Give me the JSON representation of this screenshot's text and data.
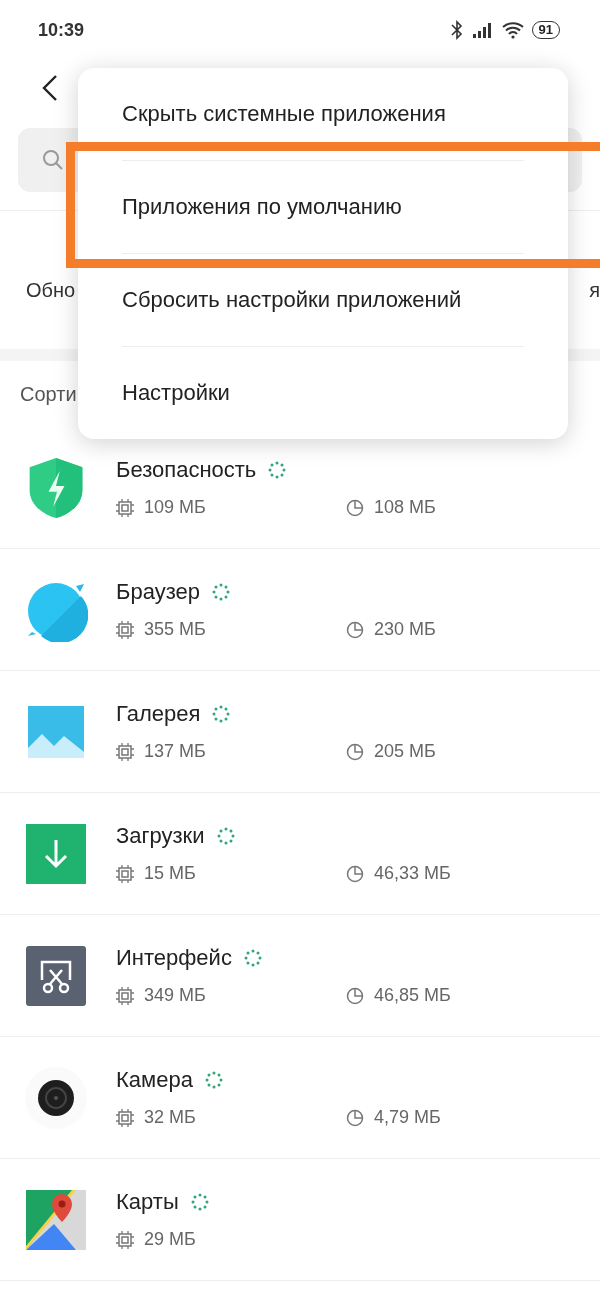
{
  "status_bar": {
    "time": "10:39",
    "battery": "91"
  },
  "tabs_partial": {
    "left": "Обно",
    "right": "я"
  },
  "sort_partial": "Сорти",
  "menu": [
    {
      "label": "Скрыть системные приложения",
      "highlighted": false
    },
    {
      "label": "Приложения по умолчанию",
      "highlighted": true
    },
    {
      "label": "Сбросить настройки приложений",
      "highlighted": false
    },
    {
      "label": "Настройки",
      "highlighted": false
    }
  ],
  "apps": [
    {
      "name": "Безопасность",
      "kind": "shield",
      "memory": "109 МБ",
      "storage": "108 МБ"
    },
    {
      "name": "Браузер",
      "kind": "planet",
      "memory": "355 МБ",
      "storage": "230 МБ"
    },
    {
      "name": "Галерея",
      "kind": "gallery",
      "memory": "137 МБ",
      "storage": "205 МБ"
    },
    {
      "name": "Загрузки",
      "kind": "download",
      "memory": "15 МБ",
      "storage": "46,33 МБ"
    },
    {
      "name": "Интерфейс",
      "kind": "scissors",
      "memory": "349 МБ",
      "storage": "46,85 МБ"
    },
    {
      "name": "Камера",
      "kind": "lens",
      "memory": "32 МБ",
      "storage": "4,79 МБ"
    },
    {
      "name": "Карты",
      "kind": "map",
      "memory": "29 МБ"
    }
  ]
}
